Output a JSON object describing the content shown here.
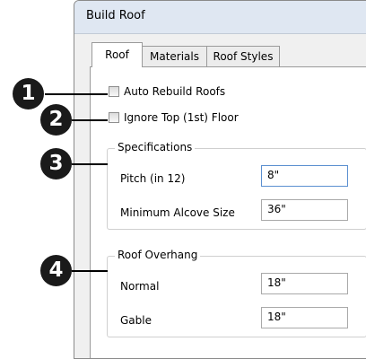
{
  "dialog": {
    "title": "Build Roof",
    "tabs": [
      {
        "label": "Roof",
        "active": true
      },
      {
        "label": "Materials",
        "active": false
      },
      {
        "label": "Roof Styles",
        "active": false
      }
    ]
  },
  "options": {
    "auto_rebuild": {
      "label": "Auto Rebuild Roofs",
      "checked": false
    },
    "ignore_top": {
      "label": "Ignore Top (1st) Floor",
      "checked": false
    }
  },
  "specifications": {
    "title": "Specifications",
    "pitch_label": "Pitch (in 12)",
    "pitch_value": "8\"",
    "alcove_label": "Minimum Alcove Size",
    "alcove_value": "36\""
  },
  "overhang": {
    "title": "Roof Overhang",
    "normal_label": "Normal",
    "normal_value": "18\"",
    "gable_label": "Gable",
    "gable_value": "18\""
  },
  "callouts": [
    "1",
    "2",
    "3",
    "4"
  ]
}
